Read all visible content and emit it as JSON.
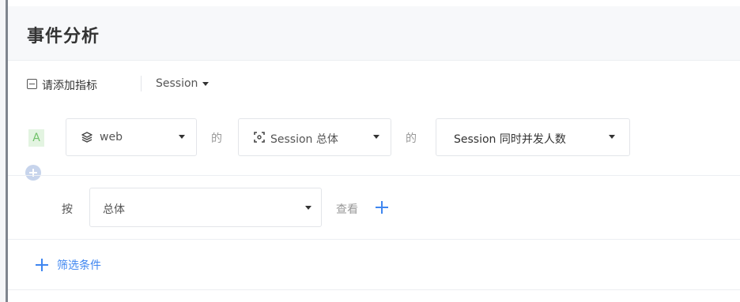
{
  "page": {
    "title": "事件分析"
  },
  "metric_header": {
    "label": "请添加指标",
    "session_dropdown": "Session"
  },
  "query_row": {
    "badge": "A",
    "source_select": "web",
    "connector_1": "的",
    "entity_select": "Session 总体",
    "connector_2": "的",
    "metric_select": "Session 同时并发人数"
  },
  "group_row": {
    "by_label": "按",
    "group_select": "总体",
    "view_label": "查看"
  },
  "filter": {
    "label": "筛选条件"
  },
  "colors": {
    "accent": "#3f86f0",
    "badge_bg": "#e3f4e1",
    "badge_text": "#71c26a",
    "header_bg": "#f7f8fa"
  }
}
